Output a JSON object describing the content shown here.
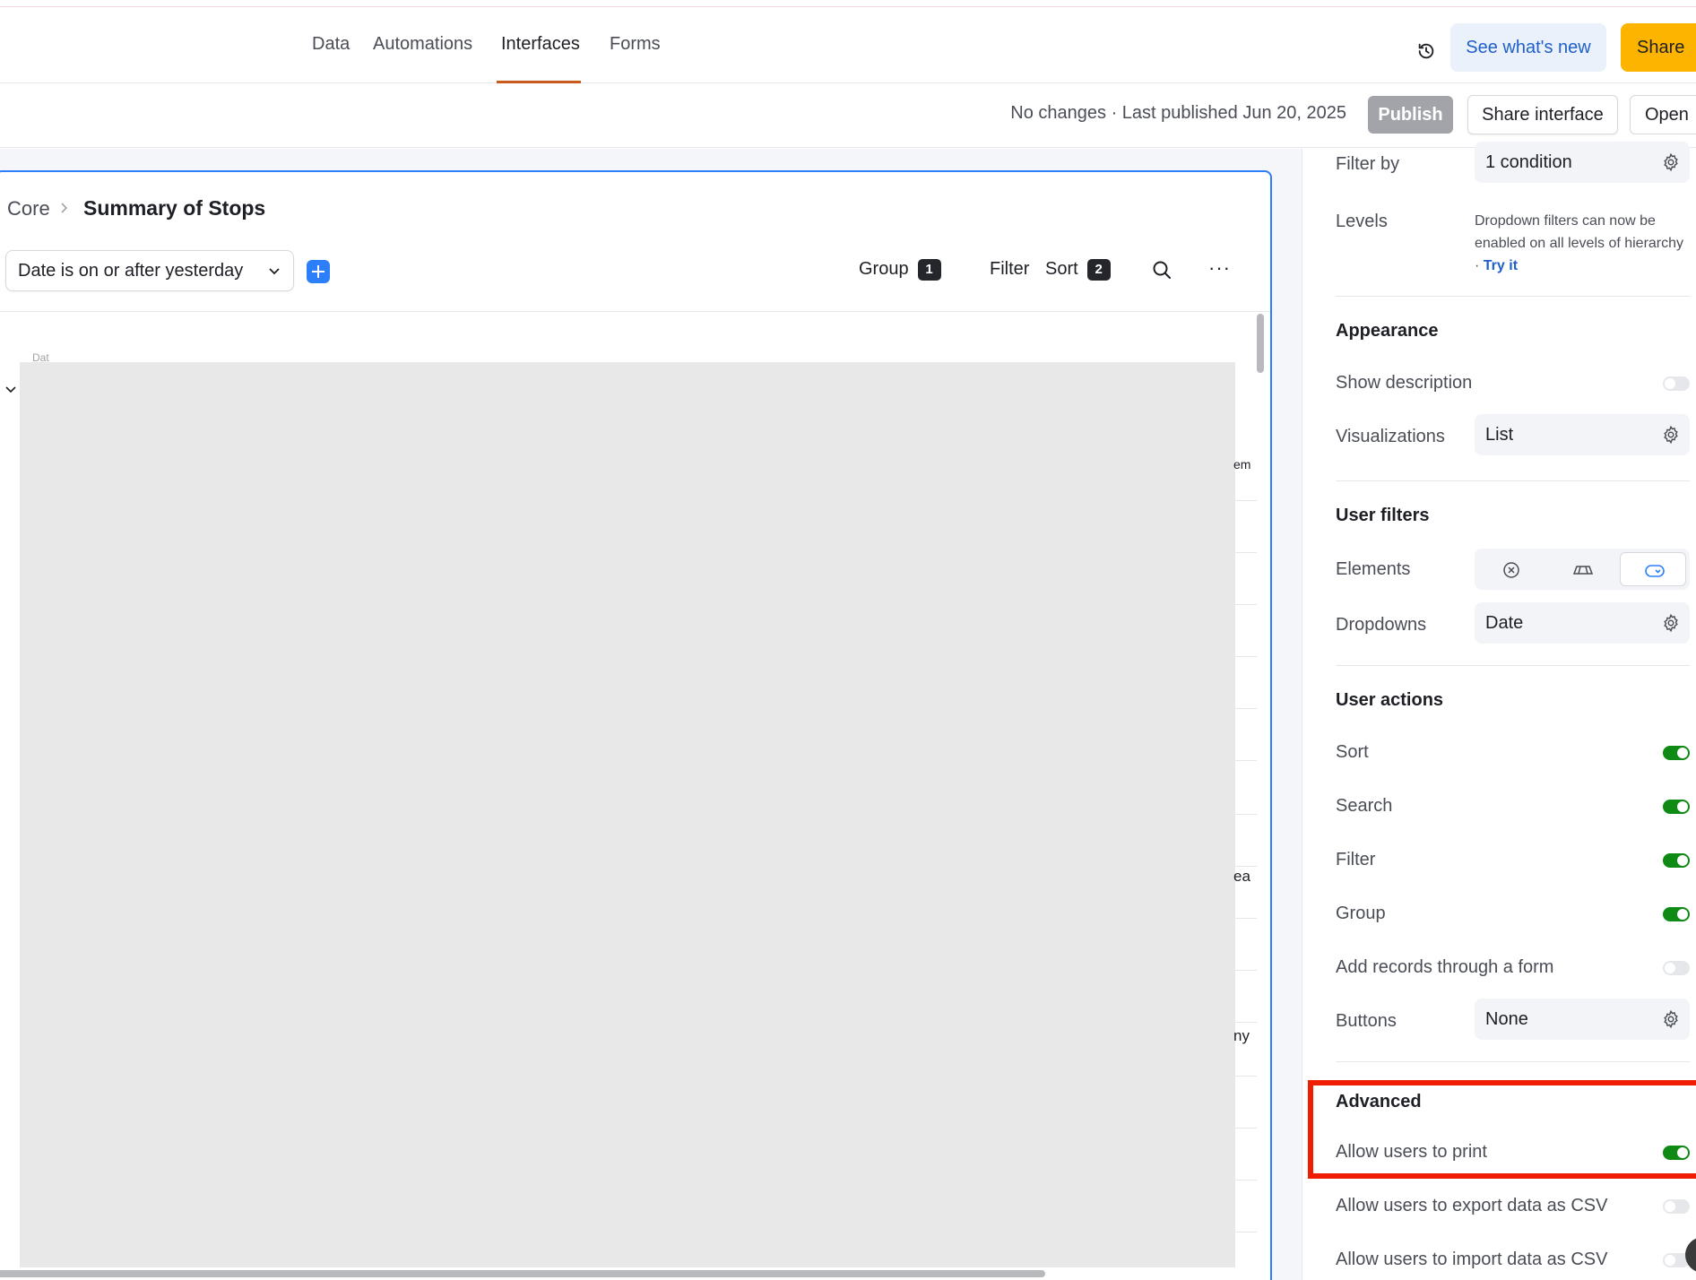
{
  "nav": {
    "tabs": [
      {
        "label": "Data"
      },
      {
        "label": "Automations"
      },
      {
        "label": "Interfaces"
      },
      {
        "label": "Forms"
      }
    ],
    "active_tab": "Interfaces",
    "whats_new": "See what's new",
    "share": "Share"
  },
  "publish_bar": {
    "status": "No changes · Last published Jun 20, 2025",
    "publish": "Publish",
    "share_interface": "Share interface",
    "open": "Open"
  },
  "page": {
    "breadcrumb_parent": "Core",
    "title": "Summary of Stops",
    "filter_pill": "Date is on or after yesterday",
    "toolbar": {
      "group_label": "Group",
      "group_count": "1",
      "filter_label": "Filter",
      "sort_label": "Sort",
      "sort_count": "2",
      "more": "···"
    },
    "faint_column_label": "Dat",
    "clipped_cells": [
      "em",
      "ea",
      "ny"
    ]
  },
  "properties": {
    "filter_by": {
      "label": "Filter by",
      "value": "1 condition"
    },
    "levels": {
      "label": "Levels",
      "hint": "Dropdown filters can now be enabled on all levels of hierarchy ·",
      "link": "Try it"
    },
    "appearance": {
      "heading": "Appearance",
      "show_description": {
        "label": "Show description",
        "on": false
      },
      "visualizations": {
        "label": "Visualizations",
        "value": "List"
      }
    },
    "user_filters": {
      "heading": "User filters",
      "elements": {
        "label": "Elements",
        "options": [
          "clear-filter-icon",
          "tabs-icon",
          "dropdown-icon"
        ],
        "selected": "dropdown-icon"
      },
      "dropdowns": {
        "label": "Dropdowns",
        "value": "Date"
      }
    },
    "user_actions": {
      "heading": "User actions",
      "sort": {
        "label": "Sort",
        "on": true
      },
      "search": {
        "label": "Search",
        "on": true
      },
      "filter": {
        "label": "Filter",
        "on": true
      },
      "group": {
        "label": "Group",
        "on": true
      },
      "add_records": {
        "label": "Add records through a form",
        "on": false
      },
      "buttons": {
        "label": "Buttons",
        "value": "None"
      }
    },
    "advanced": {
      "heading": "Advanced",
      "allow_print": {
        "label": "Allow users to print",
        "on": true
      },
      "allow_export": {
        "label": "Allow users to export data as CSV",
        "on": false
      },
      "allow_import": {
        "label": "Allow users to import data as CSV",
        "on": false
      }
    }
  },
  "colors": {
    "accent_blue": "#2d7ff9",
    "share_yellow": "#fcb400",
    "toggle_on_green": "#0f8a15",
    "highlight_red": "#f01e00",
    "active_tab_underline": "#c85a1d"
  }
}
